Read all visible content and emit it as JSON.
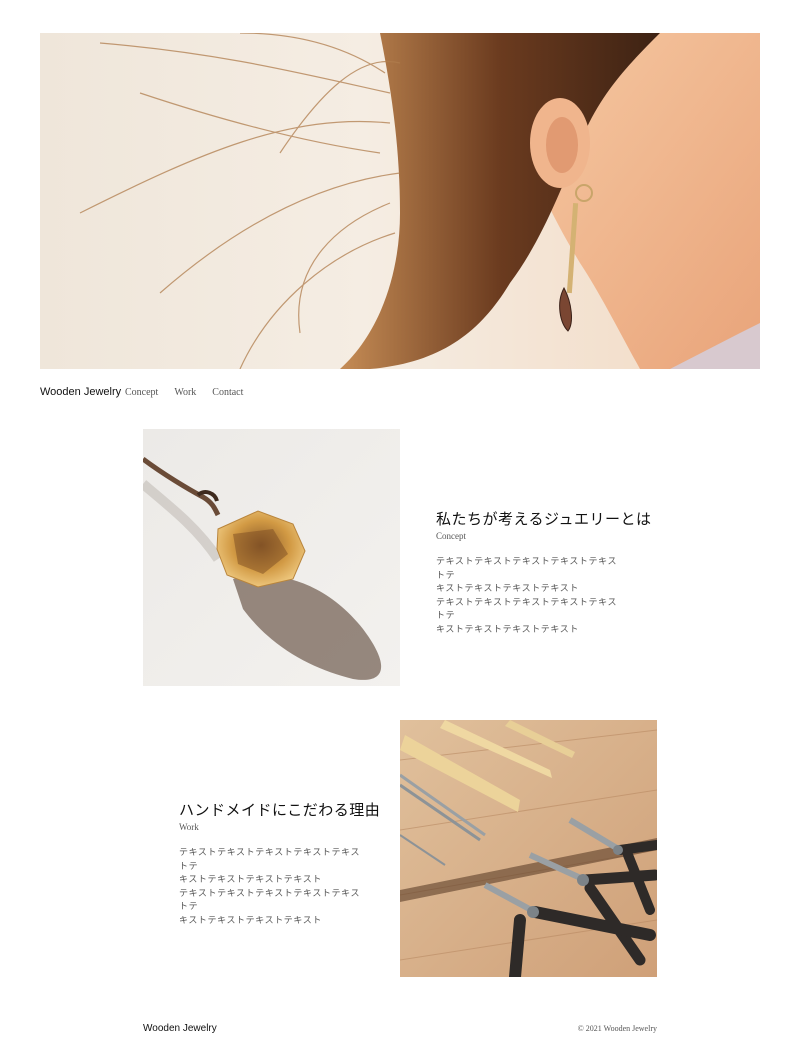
{
  "header": {
    "logo": "Wooden Jewelry",
    "nav": [
      "Concept",
      "Work",
      "Contact"
    ]
  },
  "concept": {
    "title": "私たちが考えるジュエリーとは",
    "subtitle": "Concept",
    "body": [
      "テキストテキストテキストテキストテキストテ",
      "キストテキストテキストテキスト",
      "テキストテキストテキストテキストテキストテ",
      "キストテキストテキストテキスト"
    ]
  },
  "work": {
    "title": "ハンドメイドにこだわる理由",
    "subtitle": "Work",
    "body": [
      "テキストテキストテキストテキストテキストテ",
      "キストテキストテキストテキスト",
      "テキストテキストテキストテキストテキストテ",
      "キストテキストテキストテキスト"
    ]
  },
  "footer": {
    "logo": "Wooden Jewelry",
    "copyright": "© 2021 Wooden Jewelry"
  }
}
